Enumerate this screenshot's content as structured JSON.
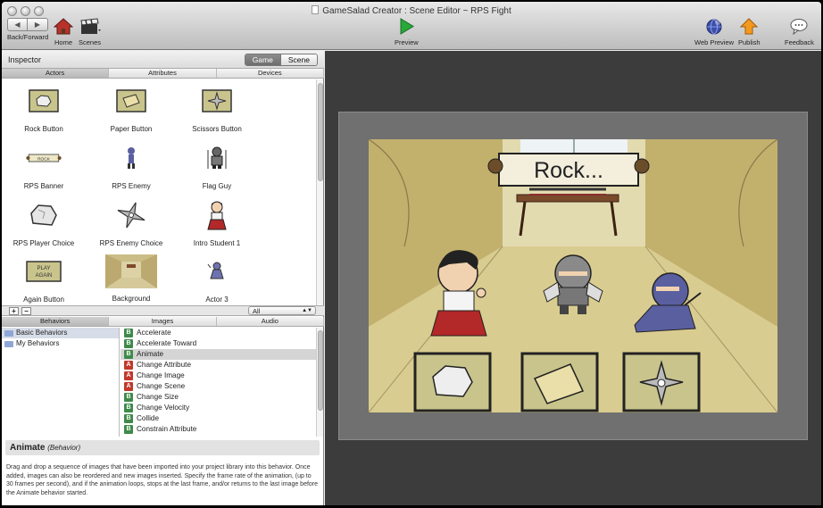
{
  "window": {
    "title": "GameSalad Creator : Scene Editor ~ RPS Fight"
  },
  "toolbar": {
    "back_forward_label": "Back/Forward",
    "home_label": "Home",
    "scenes_label": "Scenes",
    "preview_label": "Preview",
    "web_preview_label": "Web Preview",
    "publish_label": "Publish",
    "feedback_label": "Feedback"
  },
  "inspector": {
    "title": "Inspector",
    "seg_game": "Game",
    "seg_scene": "Scene",
    "tabs": [
      "Actors",
      "Attributes",
      "Devices"
    ],
    "active_tab": "Actors"
  },
  "actors": [
    {
      "name": "Rock Button",
      "icon": "rock-button-icon"
    },
    {
      "name": "Paper Button",
      "icon": "paper-button-icon"
    },
    {
      "name": "Scissors Button",
      "icon": "scissors-button-icon"
    },
    {
      "name": "RPS Banner",
      "icon": "banner-icon"
    },
    {
      "name": "RPS Enemy",
      "icon": "ninja-small-icon"
    },
    {
      "name": "Flag Guy",
      "icon": "flag-guy-icon"
    },
    {
      "name": "RPS Player Choice",
      "icon": "rock-icon"
    },
    {
      "name": "RPS Enemy Choice",
      "icon": "shuriken-icon"
    },
    {
      "name": "Intro Student 1",
      "icon": "student-icon"
    },
    {
      "name": "Again Button",
      "icon": "again-button-icon"
    },
    {
      "name": "Background",
      "icon": "background-icon"
    },
    {
      "name": "Actor 3",
      "icon": "actor3-icon"
    }
  ],
  "actor_filter": {
    "value": "All"
  },
  "library": {
    "tabs": [
      "Behaviors",
      "Images",
      "Audio"
    ],
    "active_tab": "Behaviors",
    "categories": [
      {
        "label": "Basic Behaviors",
        "selected": true
      },
      {
        "label": "My Behaviors",
        "selected": false
      }
    ],
    "items": [
      {
        "badge": "B",
        "label": "Accelerate"
      },
      {
        "badge": "B",
        "label": "Accelerate Toward"
      },
      {
        "badge": "B",
        "label": "Animate",
        "selected": true
      },
      {
        "badge": "A",
        "label": "Change Attribute"
      },
      {
        "badge": "A",
        "label": "Change Image"
      },
      {
        "badge": "A",
        "label": "Change Scene"
      },
      {
        "badge": "B",
        "label": "Change Size"
      },
      {
        "badge": "B",
        "label": "Change Velocity"
      },
      {
        "badge": "B",
        "label": "Collide"
      },
      {
        "badge": "B",
        "label": "Constrain Attribute"
      }
    ],
    "badge_colors": {
      "B": "#3f8a4a",
      "A": "#c0392b"
    }
  },
  "description": {
    "title": "Animate",
    "kind": "(Behavior)",
    "text": "Drag and drop a sequence of images that have been imported into your project library into this behavior. Once added, images can also be reordered and new images inserted. Specify the frame rate of the animation, (up to 30 frames per second), and if the animation loops, stops at the last frame, and/or returns to the last image before the Animate behavior started."
  },
  "scene": {
    "banner_text": "Rock...",
    "buttons": [
      "rock-button-icon",
      "paper-button-icon",
      "shuriken-button-icon"
    ]
  }
}
